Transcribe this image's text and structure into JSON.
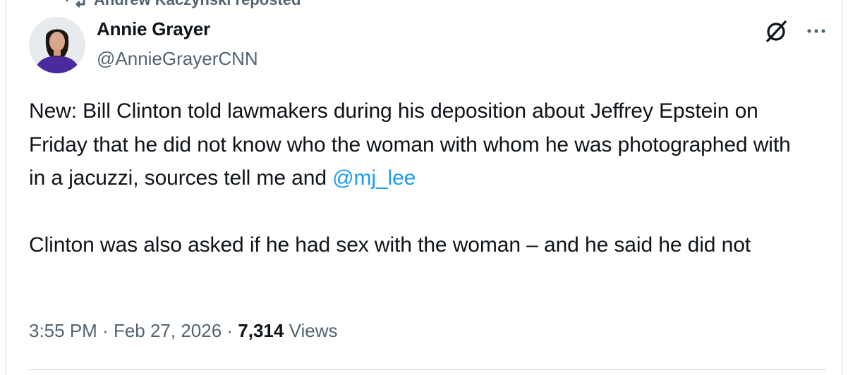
{
  "repost": {
    "text": "Andrew Kaczynski reposted"
  },
  "author": {
    "name": "Annie Grayer",
    "handle": "@AnnieGrayerCNN"
  },
  "icons": {
    "repost": "repost-icon",
    "grok": "grok-icon",
    "more": "more-icon"
  },
  "tweet": {
    "para1_text": "New: Bill Clinton told lawmakers during his deposition about Jeffrey Epstein on Friday that he did not know who the woman with whom he was photographed with in a jacuzzi, sources tell me and ",
    "para1_mention": "@mj_lee",
    "para2_text": "Clinton was also asked if he had sex with the woman – and he said he did not"
  },
  "meta": {
    "time": "3:55 PM",
    "separator": " · ",
    "date": "Feb 27, 2026",
    "views_count": "7,314",
    "views_label": " Views"
  },
  "colors": {
    "text": "#0f1419",
    "secondary": "#536471",
    "link": "#1d9bf0",
    "border": "#cfd9de",
    "avatar_outfit": "#4b2a9e"
  }
}
